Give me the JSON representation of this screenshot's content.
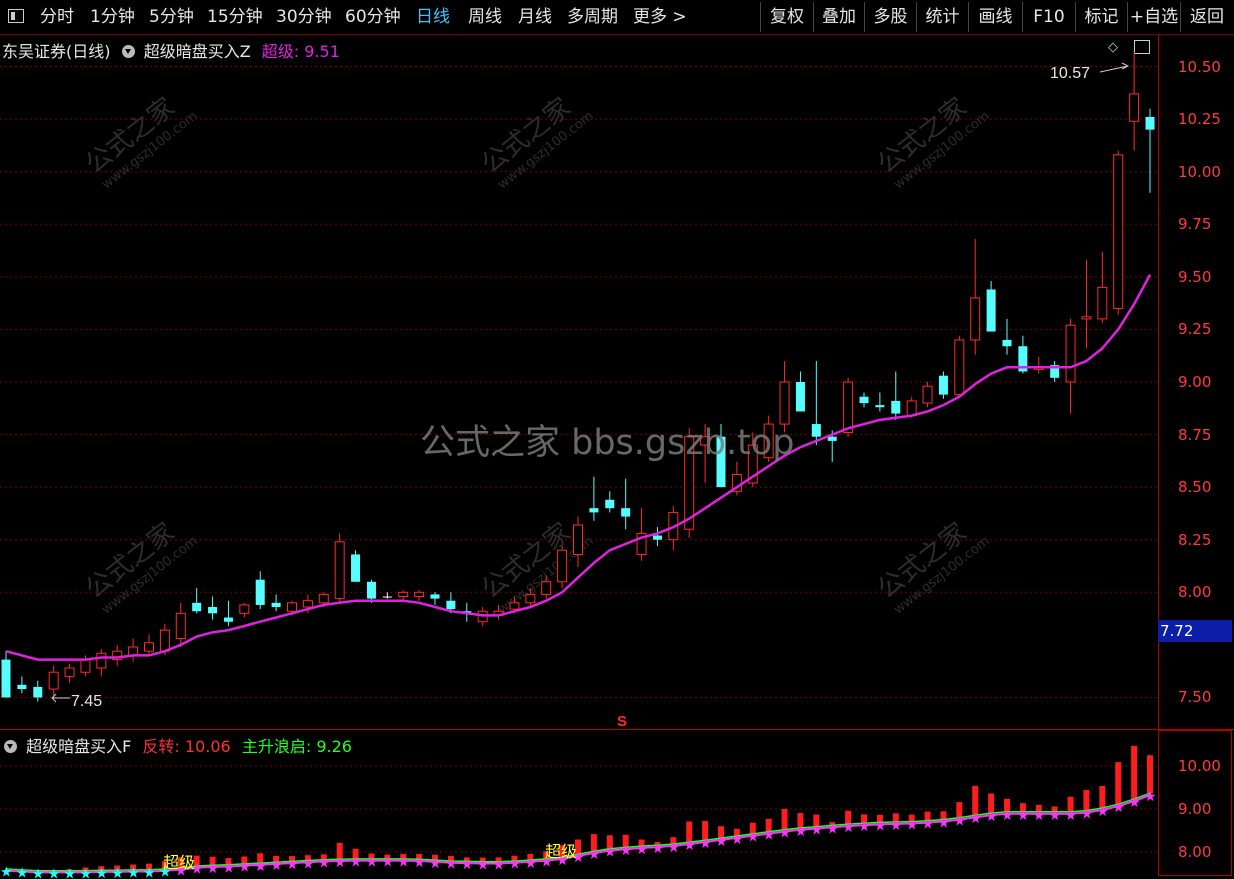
{
  "toolbar": {
    "left_items": [
      "分时",
      "1分钟",
      "5分钟",
      "15分钟",
      "30分钟",
      "60分钟",
      "日线",
      "周线",
      "月线",
      "多周期",
      "更多 >"
    ],
    "active_item": "日线",
    "right_items": [
      "复权",
      "叠加",
      "多股",
      "统计",
      "画线",
      "F10",
      "标记",
      "+自选",
      "返回"
    ]
  },
  "main_panel": {
    "stock_label": "东吴证券(日线)",
    "indicator_name": "超级暗盘买入Z",
    "indicator_line_label": "超级",
    "indicator_value": "9.51",
    "y_ticks": [
      "10.50",
      "10.25",
      "10.00",
      "9.75",
      "9.50",
      "9.25",
      "9.00",
      "8.75",
      "8.50",
      "8.25",
      "8.00",
      "7.50"
    ],
    "current_price": "7.72",
    "high_label": "10.57",
    "low_label": "7.45",
    "signal_mark": "S",
    "watermark_center": "公式之家 bbs.gszb.top",
    "watermark_tile": "公式之家",
    "watermark_tile_url": "www.gszj100.com",
    "colors": {
      "up": "#ff2a2a",
      "down": "#55ffff",
      "ma": "#e022e0"
    }
  },
  "sub_panel": {
    "indicator_name": "超级暗盘买入F",
    "series": [
      {
        "name": "反转",
        "value": "10.06",
        "color": "#ff3030"
      },
      {
        "name": "主升浪启",
        "value": "9.26",
        "color": "#22ff22"
      }
    ],
    "y_ticks": [
      "10.00",
      "9.00",
      "8.00"
    ],
    "signal_text": "超级"
  },
  "chart_data": {
    "type": "candlestick",
    "ylim": [
      7.35,
      10.65
    ],
    "candles": [
      [
        7.68,
        7.72,
        7.52,
        7.5
      ],
      [
        7.56,
        7.6,
        7.52,
        7.54
      ],
      [
        7.55,
        7.58,
        7.48,
        7.5
      ],
      [
        7.54,
        7.65,
        7.5,
        7.62
      ],
      [
        7.6,
        7.66,
        7.57,
        7.64
      ],
      [
        7.62,
        7.7,
        7.6,
        7.68
      ],
      [
        7.64,
        7.73,
        7.6,
        7.71
      ],
      [
        7.68,
        7.75,
        7.65,
        7.72
      ],
      [
        7.7,
        7.78,
        7.67,
        7.74
      ],
      [
        7.72,
        7.8,
        7.7,
        7.76
      ],
      [
        7.72,
        7.85,
        7.7,
        7.82
      ],
      [
        7.78,
        7.95,
        7.74,
        7.9
      ],
      [
        7.95,
        8.02,
        7.9,
        7.91
      ],
      [
        7.93,
        7.98,
        7.87,
        7.9
      ],
      [
        7.88,
        7.96,
        7.84,
        7.86
      ],
      [
        7.9,
        7.95,
        7.88,
        7.94
      ],
      [
        8.06,
        8.1,
        7.92,
        7.94
      ],
      [
        7.95,
        7.99,
        7.91,
        7.93
      ],
      [
        7.91,
        7.96,
        7.89,
        7.95
      ],
      [
        7.93,
        7.99,
        7.9,
        7.96
      ],
      [
        7.95,
        8.0,
        7.93,
        7.99
      ],
      [
        7.97,
        8.28,
        7.95,
        8.24
      ],
      [
        8.18,
        8.2,
        8.05,
        8.05
      ],
      [
        8.05,
        8.06,
        7.95,
        7.97
      ],
      [
        7.98,
        8.0,
        7.97,
        7.98
      ],
      [
        7.98,
        8.01,
        7.96,
        8.0
      ],
      [
        7.98,
        8.01,
        7.96,
        8.0
      ],
      [
        7.99,
        8.0,
        7.94,
        7.97
      ],
      [
        7.96,
        8.0,
        7.9,
        7.92
      ],
      [
        7.91,
        7.95,
        7.86,
        7.9
      ],
      [
        7.86,
        7.93,
        7.84,
        7.91
      ],
      [
        7.89,
        7.94,
        7.87,
        7.91
      ],
      [
        7.92,
        7.98,
        7.9,
        7.95
      ],
      [
        7.95,
        8.02,
        7.93,
        7.99
      ],
      [
        7.99,
        8.08,
        7.97,
        8.05
      ],
      [
        8.05,
        8.22,
        8.02,
        8.2
      ],
      [
        8.18,
        8.36,
        8.12,
        8.32
      ],
      [
        8.4,
        8.55,
        8.34,
        8.38
      ],
      [
        8.44,
        8.48,
        8.38,
        8.4
      ],
      [
        8.4,
        8.54,
        8.3,
        8.36
      ],
      [
        8.18,
        8.4,
        8.15,
        8.28
      ],
      [
        8.27,
        8.31,
        8.22,
        8.25
      ],
      [
        8.25,
        8.41,
        8.2,
        8.38
      ],
      [
        8.3,
        8.78,
        8.26,
        8.74
      ],
      [
        8.7,
        8.8,
        8.52,
        8.74
      ],
      [
        8.74,
        8.8,
        8.5,
        8.5
      ],
      [
        8.48,
        8.62,
        8.46,
        8.56
      ],
      [
        8.52,
        8.76,
        8.5,
        8.7
      ],
      [
        8.64,
        8.84,
        8.62,
        8.8
      ],
      [
        8.8,
        9.1,
        8.76,
        9.0
      ],
      [
        9.0,
        9.05,
        8.86,
        8.86
      ],
      [
        8.8,
        9.1,
        8.7,
        8.74
      ],
      [
        8.74,
        8.77,
        8.62,
        8.72
      ],
      [
        8.76,
        9.02,
        8.74,
        9.0
      ],
      [
        8.93,
        8.95,
        8.88,
        8.9
      ],
      [
        8.89,
        8.95,
        8.86,
        8.88
      ],
      [
        8.91,
        9.05,
        8.82,
        8.85
      ],
      [
        8.84,
        8.93,
        8.83,
        8.91
      ],
      [
        8.9,
        9.0,
        8.88,
        8.98
      ],
      [
        9.03,
        9.05,
        8.92,
        8.94
      ],
      [
        8.94,
        9.22,
        8.93,
        9.2
      ],
      [
        9.2,
        9.68,
        9.13,
        9.4
      ],
      [
        9.44,
        9.48,
        9.25,
        9.24
      ],
      [
        9.2,
        9.3,
        9.13,
        9.17
      ],
      [
        9.17,
        9.22,
        9.04,
        9.05
      ],
      [
        9.06,
        9.12,
        9.04,
        9.07
      ],
      [
        9.08,
        9.1,
        9.0,
        9.02
      ],
      [
        9.0,
        9.3,
        8.85,
        9.27
      ],
      [
        9.3,
        9.58,
        9.16,
        9.31
      ],
      [
        9.3,
        9.62,
        9.28,
        9.45
      ],
      [
        9.35,
        10.1,
        9.32,
        10.08
      ],
      [
        10.24,
        10.57,
        10.1,
        10.37
      ],
      [
        10.26,
        10.3,
        9.9,
        10.2
      ]
    ],
    "ma_line": [
      7.72,
      7.7,
      7.68,
      7.68,
      7.68,
      7.68,
      7.69,
      7.69,
      7.7,
      7.7,
      7.72,
      7.75,
      7.79,
      7.81,
      7.82,
      7.84,
      7.86,
      7.88,
      7.9,
      7.92,
      7.94,
      7.95,
      7.96,
      7.96,
      7.96,
      7.96,
      7.95,
      7.93,
      7.91,
      7.9,
      7.89,
      7.89,
      7.91,
      7.93,
      7.96,
      8.0,
      8.07,
      8.14,
      8.2,
      8.23,
      8.26,
      8.28,
      8.31,
      8.35,
      8.4,
      8.45,
      8.5,
      8.55,
      8.6,
      8.65,
      8.69,
      8.72,
      8.75,
      8.78,
      8.8,
      8.82,
      8.83,
      8.84,
      8.86,
      8.89,
      8.93,
      8.99,
      9.04,
      9.07,
      9.07,
      9.07,
      9.07,
      9.07,
      9.1,
      9.16,
      9.25,
      9.37,
      9.51
    ]
  }
}
